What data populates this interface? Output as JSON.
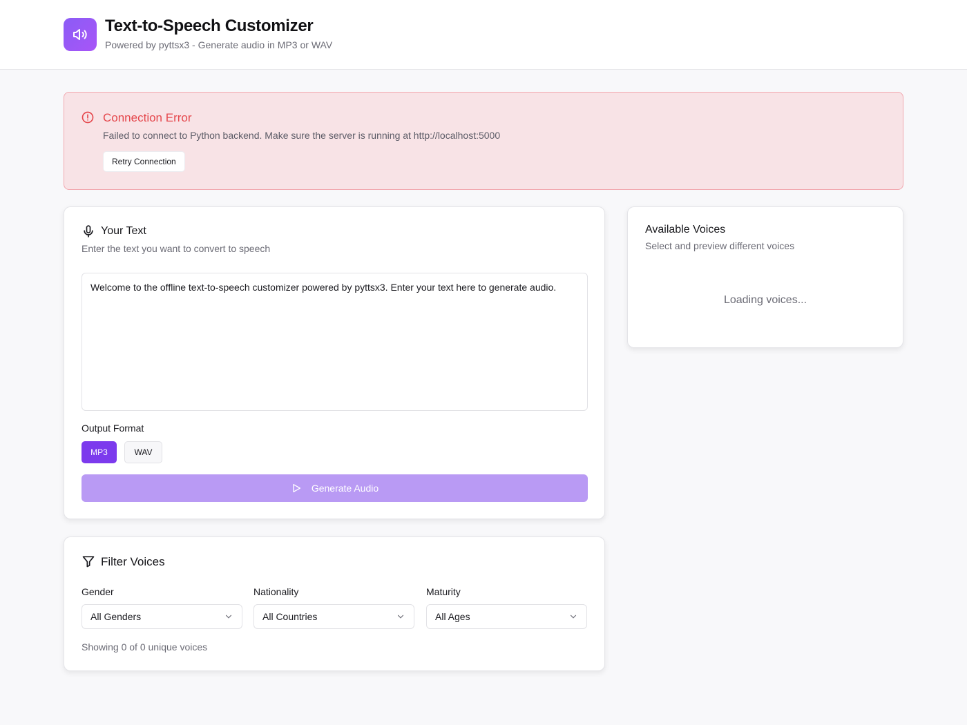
{
  "header": {
    "title": "Text-to-Speech Customizer",
    "subtitle": "Powered by pyttsx3 - Generate audio in MP3 or WAV",
    "logo_icon": "speaker-icon",
    "accent": "#8b5cf6"
  },
  "error": {
    "title": "Connection Error",
    "message": "Failed to connect to Python backend. Make sure the server is running at http://localhost:5000",
    "retry_label": "Retry Connection",
    "color": "#e5484d"
  },
  "text_card": {
    "title": "Your Text",
    "description": "Enter the text you want to convert to speech",
    "text_value": "Welcome to the offline text-to-speech customizer powered by pyttsx3. Enter your text here to generate audio.",
    "output_format_label": "Output Format",
    "formats": [
      "MP3",
      "WAV"
    ],
    "selected_format": "MP3",
    "generate_label": "Generate Audio"
  },
  "filter_card": {
    "title": "Filter Voices",
    "gender_label": "Gender",
    "gender_value": "All Genders",
    "nationality_label": "Nationality",
    "nationality_value": "All Countries",
    "maturity_label": "Maturity",
    "maturity_value": "All Ages",
    "showing_text": "Showing 0 of 0 unique voices"
  },
  "voices_card": {
    "title": "Available Voices",
    "description": "Select and preview different voices",
    "loading_text": "Loading voices..."
  }
}
